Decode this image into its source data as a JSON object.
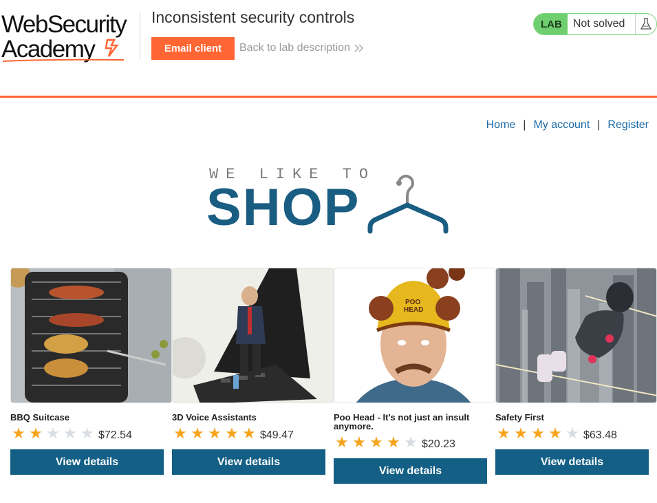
{
  "header": {
    "logo_line1": "WebSecurity",
    "logo_line2": "Academy",
    "lab_title": "Inconsistent security controls",
    "email_button": "Email client",
    "back_link": "Back to lab description",
    "lab_badge": "LAB",
    "lab_status": "Not solved",
    "colors": {
      "accent": "#ff6633",
      "lab_green": "#6fcf6f",
      "button_blue": "#135f85",
      "link_blue": "#1a6aa6"
    }
  },
  "nav": {
    "home": "Home",
    "my_account": "My account",
    "register": "Register",
    "separator": "|"
  },
  "banner": {
    "we_like_to": "WE LIKE TO",
    "shop": "SHOP"
  },
  "products": [
    {
      "name": "BBQ Suitcase",
      "rating": 2,
      "price": "$72.54",
      "button": "View details"
    },
    {
      "name": "3D Voice Assistants",
      "rating": 5,
      "price": "$49.47",
      "button": "View details"
    },
    {
      "name": "Poo Head - It's not just an insult anymore.",
      "rating": 4,
      "price": "$20.23",
      "button": "View details"
    },
    {
      "name": "Safety First",
      "rating": 4,
      "price": "$63.48",
      "button": "View details"
    }
  ]
}
